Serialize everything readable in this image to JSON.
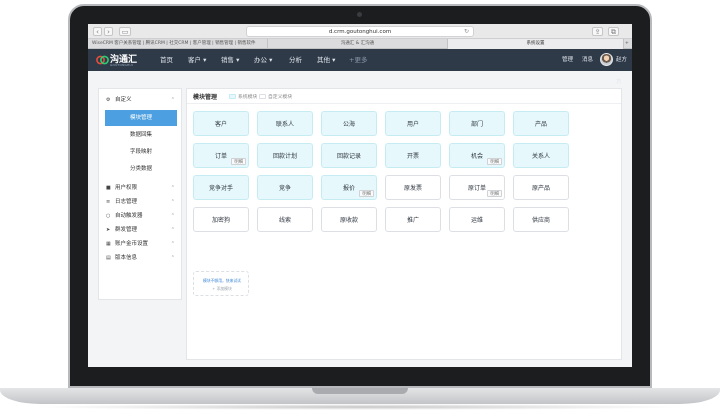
{
  "browser": {
    "url": "d.crm.goutonghui.com",
    "tabs": [
      "WiseCRM 客户关系管理 | 腾讯CRM | 社交CRM | 客户管理 | 销售管理 | 销售软件",
      "沟通汇 & 汇沟通",
      "系统设置"
    ]
  },
  "app": {
    "logo_text": "沟通汇",
    "logo_sub": "GOUTONGHUI",
    "nav": [
      "首页",
      "客户",
      "销售",
      "办公",
      "分析",
      "其他"
    ],
    "nav_add": "+更多",
    "nav_right": [
      "管理",
      "消息",
      "赵方方"
    ]
  },
  "sidebar": {
    "groups": [
      {
        "label": "自定义",
        "icon": "gear-icon",
        "subitems": [
          {
            "label": "模块管理",
            "active": true
          },
          {
            "label": "数据回集",
            "active": false
          },
          {
            "label": "字段映射",
            "active": false
          },
          {
            "label": "分类数据",
            "active": false
          }
        ]
      },
      {
        "label": "用户权限",
        "icon": "lock-icon"
      },
      {
        "label": "日志管理",
        "icon": "list-icon"
      },
      {
        "label": "自动触发器",
        "icon": "circle-icon"
      },
      {
        "label": "群发管理",
        "icon": "send-icon"
      },
      {
        "label": "账户金币设置",
        "icon": "grid-icon"
      },
      {
        "label": "版本信息",
        "icon": "book-icon"
      }
    ]
  },
  "panel": {
    "title": "模块管理",
    "legend_system": "系统模块",
    "legend_custom": "自定义模块",
    "colors": {
      "system_bg": "#e6f8fb",
      "system_border": "#c6ecf3",
      "custom_bg": "#ffffff",
      "accent": "#4c9fe0"
    }
  },
  "modules": [
    {
      "label": "客户",
      "type": "system"
    },
    {
      "label": "联系人",
      "type": "system"
    },
    {
      "label": "公海",
      "type": "system"
    },
    {
      "label": "用户",
      "type": "system"
    },
    {
      "label": "部门",
      "type": "system"
    },
    {
      "label": "产品",
      "type": "system"
    },
    {
      "label": "订单",
      "type": "system",
      "tag": "明细"
    },
    {
      "label": "回款计划",
      "type": "system"
    },
    {
      "label": "回款记录",
      "type": "system"
    },
    {
      "label": "开票",
      "type": "system"
    },
    {
      "label": "机会",
      "type": "system",
      "tag": "明细"
    },
    {
      "label": "关系人",
      "type": "system"
    },
    {
      "label": "竞争对手",
      "type": "system"
    },
    {
      "label": "竞争",
      "type": "system"
    },
    {
      "label": "报价",
      "type": "system",
      "tag": "明细"
    },
    {
      "label": "原发票",
      "type": "custom"
    },
    {
      "label": "原订单",
      "type": "custom",
      "tag": "明细"
    },
    {
      "label": "原产品",
      "type": "custom"
    },
    {
      "label": "加密狗",
      "type": "custom"
    },
    {
      "label": "线索",
      "type": "custom"
    },
    {
      "label": "原收款",
      "type": "custom"
    },
    {
      "label": "推广",
      "type": "custom"
    },
    {
      "label": "运维",
      "type": "custom"
    },
    {
      "label": "供应商",
      "type": "custom"
    }
  ],
  "add_module": {
    "hint": "模块不够用，快来试试",
    "button": "+ 添加模块"
  }
}
